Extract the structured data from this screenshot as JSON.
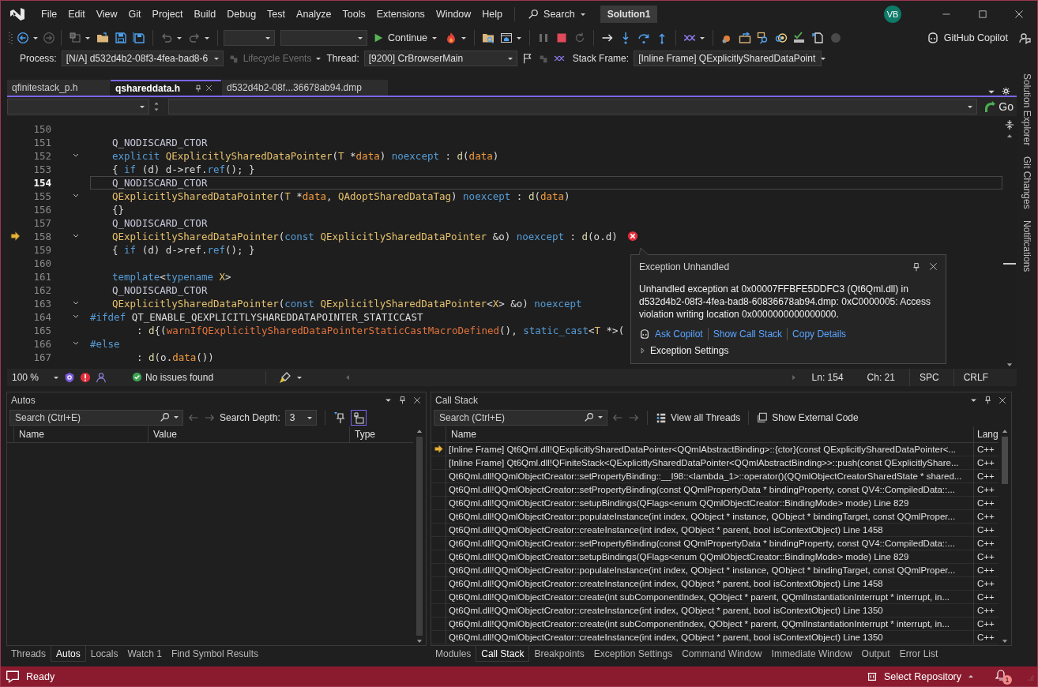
{
  "menu": {
    "items": [
      "File",
      "Edit",
      "View",
      "Git",
      "Project",
      "Build",
      "Debug",
      "Test",
      "Analyze",
      "Tools",
      "Extensions",
      "Window",
      "Help"
    ],
    "search": "Search",
    "solution": "Solution1",
    "avatar": "VB"
  },
  "toolbar": {
    "continue": "Continue",
    "copilot": "GitHub Copilot"
  },
  "debug_location": {
    "process_label": "Process:",
    "process": "[N/A] d532d4b2-08f3-4fea-bad8-6",
    "lifecycle": {
      "label": "Lifecycle Events",
      "disabled": true
    },
    "thread_label": "Thread:",
    "thread": "[9200] CrBrowserMain",
    "frame_label": "Stack Frame:",
    "frame": "[Inline Frame] QExplicitlySharedDataPoint"
  },
  "doc_tabs": [
    {
      "label": "qfinitestack_p.h",
      "selected": false
    },
    {
      "label": "qshareddata.h",
      "selected": true
    },
    {
      "label": "d532d4b2-08f...36678ab94.dmp",
      "selected": false
    }
  ],
  "nav_bar": {
    "go": "Go"
  },
  "editor": {
    "lines": [
      {
        "num": "150",
        "kind": "code",
        "fold": false,
        "current": false,
        "instruction_pointer": false,
        "error": false
      },
      {
        "num": "151",
        "kind": "code",
        "fold": false,
        "current": false,
        "instruction_pointer": false,
        "error": false,
        "tokens": [
          {
            "kind": "macro",
            "text": "Q_NODISCARD_CTOR"
          }
        ]
      },
      {
        "num": "152",
        "kind": "code",
        "fold": true,
        "current": false,
        "instruction_pointer": false,
        "error": false,
        "tokens": [
          {
            "kind": "kw",
            "text": "explicit "
          },
          {
            "kind": "type",
            "text": "QExplicitlySharedDataPointer"
          },
          {
            "kind": "plain",
            "text": "("
          },
          {
            "kind": "type",
            "text": "T"
          },
          {
            "kind": "plain",
            "text": " *"
          },
          {
            "kind": "param",
            "text": "data"
          },
          {
            "kind": "plain",
            "text": ") "
          },
          {
            "kind": "kw",
            "text": "noexcept"
          },
          {
            "kind": "plain",
            "text": " : "
          },
          {
            "kind": "fn",
            "text": "d"
          },
          {
            "kind": "plain",
            "text": "("
          },
          {
            "kind": "param",
            "text": "data"
          },
          {
            "kind": "plain",
            "text": ")"
          }
        ]
      },
      {
        "num": "153",
        "kind": "code",
        "fold": false,
        "current": false,
        "instruction_pointer": false,
        "error": false,
        "tokens": [
          {
            "kind": "plain",
            "text": "{ "
          },
          {
            "kind": "kw",
            "text": "if"
          },
          {
            "kind": "plain",
            "text": " (d) d->ref."
          },
          {
            "kind": "kw",
            "text": "ref"
          },
          {
            "kind": "plain",
            "text": "(); }"
          }
        ]
      },
      {
        "num": "154",
        "kind": "code",
        "fold": false,
        "current": true,
        "instruction_pointer": false,
        "error": false,
        "tokens": [
          {
            "kind": "macro",
            "text": "Q_NODISCARD_CTOR"
          }
        ]
      },
      {
        "num": "155",
        "kind": "code",
        "fold": true,
        "current": false,
        "instruction_pointer": false,
        "error": false,
        "tokens": [
          {
            "kind": "type",
            "text": "QExplicitlySharedDataPointer"
          },
          {
            "kind": "plain",
            "text": "("
          },
          {
            "kind": "type",
            "text": "T"
          },
          {
            "kind": "plain",
            "text": " *"
          },
          {
            "kind": "param",
            "text": "data"
          },
          {
            "kind": "plain",
            "text": ", "
          },
          {
            "kind": "type",
            "text": "QAdoptSharedDataTag"
          },
          {
            "kind": "plain",
            "text": ") "
          },
          {
            "kind": "kw",
            "text": "noexcept"
          },
          {
            "kind": "plain",
            "text": " : "
          },
          {
            "kind": "fn",
            "text": "d"
          },
          {
            "kind": "plain",
            "text": "("
          },
          {
            "kind": "param",
            "text": "data"
          },
          {
            "kind": "plain",
            "text": ")"
          }
        ]
      },
      {
        "num": "156",
        "kind": "code",
        "fold": false,
        "current": false,
        "instruction_pointer": false,
        "error": false,
        "tokens": [
          {
            "kind": "plain",
            "text": "{}"
          }
        ]
      },
      {
        "num": "157",
        "kind": "code",
        "fold": false,
        "current": false,
        "instruction_pointer": false,
        "error": false,
        "tokens": [
          {
            "kind": "macro",
            "text": "Q_NODISCARD_CTOR"
          }
        ]
      },
      {
        "num": "158",
        "kind": "code",
        "fold": true,
        "current": false,
        "instruction_pointer": true,
        "error": true,
        "tokens": [
          {
            "kind": "type",
            "text": "QExplicitlySharedDataPointer"
          },
          {
            "kind": "plain",
            "text": "("
          },
          {
            "kind": "kw",
            "text": "const "
          },
          {
            "kind": "type",
            "text": "QExplicitlySharedDataPointer"
          },
          {
            "kind": "plain",
            "text": " &o) "
          },
          {
            "kind": "kw",
            "text": "noexcept"
          },
          {
            "kind": "plain",
            "text": " : "
          },
          {
            "kind": "fn",
            "text": "d"
          },
          {
            "kind": "plain",
            "text": "(o.d)"
          }
        ]
      },
      {
        "num": "159",
        "kind": "code",
        "fold": false,
        "current": false,
        "instruction_pointer": false,
        "error": false,
        "tokens": [
          {
            "kind": "plain",
            "text": "{ "
          },
          {
            "kind": "kw",
            "text": "if"
          },
          {
            "kind": "plain",
            "text": " (d) d->ref."
          },
          {
            "kind": "kw",
            "text": "ref"
          },
          {
            "kind": "plain",
            "text": "(); }"
          }
        ]
      },
      {
        "num": "160",
        "kind": "code",
        "fold": false,
        "current": false,
        "instruction_pointer": false,
        "error": false
      },
      {
        "num": "161",
        "kind": "code",
        "fold": false,
        "current": false,
        "instruction_pointer": false,
        "error": false,
        "tokens": [
          {
            "kind": "kw",
            "text": "template"
          },
          {
            "kind": "plain",
            "text": "<"
          },
          {
            "kind": "kw",
            "text": "typename "
          },
          {
            "kind": "type",
            "text": "X"
          },
          {
            "kind": "plain",
            "text": ">"
          }
        ]
      },
      {
        "num": "162",
        "kind": "code",
        "fold": false,
        "current": false,
        "instruction_pointer": false,
        "error": false,
        "tokens": [
          {
            "kind": "macro",
            "text": "Q_NODISCARD_CTOR"
          }
        ]
      },
      {
        "num": "163",
        "kind": "code",
        "fold": true,
        "current": false,
        "instruction_pointer": false,
        "error": false,
        "tokens": [
          {
            "kind": "type",
            "text": "QExplicitlySharedDataPointer"
          },
          {
            "kind": "plain",
            "text": "("
          },
          {
            "kind": "kw",
            "text": "const "
          },
          {
            "kind": "type",
            "text": "QExplicitlySharedDataPointer"
          },
          {
            "kind": "plain",
            "text": "<"
          },
          {
            "kind": "type",
            "text": "X"
          },
          {
            "kind": "plain",
            "text": "> &o) "
          },
          {
            "kind": "kw",
            "text": "noexcept"
          }
        ]
      },
      {
        "num": "164",
        "kind": "directive",
        "fold": true,
        "current": false,
        "instruction_pointer": false,
        "error": false,
        "tokens": [
          {
            "kind": "kw",
            "text": "#ifdef"
          },
          {
            "kind": "plain",
            "text": " QT_ENABLE_QEXPLICITLYSHAREDDATAPOINTER_STATICCAST"
          }
        ]
      },
      {
        "num": "165",
        "kind": "continuation",
        "fold": false,
        "current": false,
        "instruction_pointer": false,
        "error": false,
        "tokens": [
          {
            "kind": "plain",
            "text": ": "
          },
          {
            "kind": "fn",
            "text": "d"
          },
          {
            "kind": "plain",
            "text": "{("
          },
          {
            "kind": "macrofn",
            "text": "warnIfQExplicitlySharedDataPointerStaticCastMacroDefined"
          },
          {
            "kind": "plain",
            "text": "(), "
          },
          {
            "kind": "kw",
            "text": "static_cast"
          },
          {
            "kind": "plain",
            "text": "<"
          },
          {
            "kind": "type",
            "text": "T"
          },
          {
            "kind": "plain",
            "text": " *>("
          }
        ]
      },
      {
        "num": "166",
        "kind": "directive",
        "fold": true,
        "current": false,
        "instruction_pointer": false,
        "error": false,
        "tokens": [
          {
            "kind": "kw",
            "text": "#else"
          }
        ]
      },
      {
        "num": "167",
        "kind": "continuation",
        "fold": false,
        "current": false,
        "instruction_pointer": false,
        "error": false,
        "tokens": [
          {
            "kind": "plain",
            "text": ": "
          },
          {
            "kind": "fn",
            "text": "d"
          },
          {
            "kind": "plain",
            "text": "(o."
          },
          {
            "kind": "param",
            "text": "data"
          },
          {
            "kind": "plain",
            "text": "())"
          }
        ]
      }
    ]
  },
  "editor_status": {
    "zoom": "100 %",
    "issues": "No issues found",
    "line": "Ln: 154",
    "col": "Ch: 21",
    "whitespace": "SPC",
    "line_ending": "CRLF"
  },
  "exception_popup": {
    "title": "Exception Unhandled",
    "message": "Unhandled exception at 0x00007FFBFE5DDFC3 (Qt6Qml.dll) in d532d4b2-08f3-4fea-bad8-60836678ab94.dmp: 0xC0000005: Access violation writing location 0x0000000000000000.",
    "links": [
      "Ask Copilot",
      "Show Call Stack",
      "Copy Details"
    ],
    "settings": {
      "label": "Exception Settings",
      "expanded": false
    }
  },
  "autos": {
    "title": "Autos",
    "search_placeholder": "Search (Ctrl+E)",
    "depth_label": "Search Depth:",
    "depth": "3",
    "columns": [
      "Name",
      "Value",
      "Type"
    ],
    "tabs": [
      {
        "label": "Threads",
        "selected": false
      },
      {
        "label": "Autos",
        "selected": true
      },
      {
        "label": "Locals",
        "selected": false
      },
      {
        "label": "Watch 1",
        "selected": false
      },
      {
        "label": "Find Symbol Results",
        "selected": false
      }
    ]
  },
  "call_stack": {
    "title": "Call Stack",
    "search_placeholder": "Search (Ctrl+E)",
    "view_threads": "View all Threads",
    "external_code": "Show External Code",
    "columns": [
      "Name",
      "Lang"
    ],
    "rows": [
      {
        "name": "[Inline Frame] Qt6Qml.dll!QExplicitlySharedDataPointer<QQmlAbstractBinding>::{ctor}(const QExplicitlySharedDataPointer<...",
        "lang": "C++",
        "current": true
      },
      {
        "name": "[Inline Frame] Qt6Qml.dll!QFiniteStack<QExplicitlySharedDataPointer<QQmlAbstractBinding>>::push(const QExplicitlyShare...",
        "lang": "C++",
        "current": false
      },
      {
        "name": "Qt6Qml.dll!QQmlObjectCreator::setPropertyBinding::__l98::<lambda_1>::operator()(QQmlObjectCreatorSharedState * shared...",
        "lang": "C++",
        "current": false
      },
      {
        "name": "Qt6Qml.dll!QQmlObjectCreator::setPropertyBinding(const QQmlPropertyData * bindingProperty, const QV4::CompiledData::...",
        "lang": "C++",
        "current": false
      },
      {
        "name": "Qt6Qml.dll!QQmlObjectCreator::setupBindings(QFlags<enum QQmlObjectCreator::BindingMode> mode) Line 829",
        "lang": "C++",
        "current": false
      },
      {
        "name": "Qt6Qml.dll!QQmlObjectCreator::populateInstance(int index, QObject * instance, QObject * bindingTarget, const QQmlProper...",
        "lang": "C++",
        "current": false
      },
      {
        "name": "Qt6Qml.dll!QQmlObjectCreator::createInstance(int index, QObject * parent, bool isContextObject) Line 1458",
        "lang": "C++",
        "current": false
      },
      {
        "name": "Qt6Qml.dll!QQmlObjectCreator::setPropertyBinding(const QQmlPropertyData * bindingProperty, const QV4::CompiledData::...",
        "lang": "C++",
        "current": false
      },
      {
        "name": "Qt6Qml.dll!QQmlObjectCreator::setupBindings(QFlags<enum QQmlObjectCreator::BindingMode> mode) Line 829",
        "lang": "C++",
        "current": false
      },
      {
        "name": "Qt6Qml.dll!QQmlObjectCreator::populateInstance(int index, QObject * instance, QObject * bindingTarget, const QQmlProper...",
        "lang": "C++",
        "current": false
      },
      {
        "name": "Qt6Qml.dll!QQmlObjectCreator::createInstance(int index, QObject * parent, bool isContextObject) Line 1458",
        "lang": "C++",
        "current": false
      },
      {
        "name": "Qt6Qml.dll!QQmlObjectCreator::create(int subComponentIndex, QObject * parent, QQmlInstantiationInterrupt * interrupt, in...",
        "lang": "C++",
        "current": false
      },
      {
        "name": "Qt6Qml.dll!QQmlObjectCreator::createInstance(int index, QObject * parent, bool isContextObject) Line 1350",
        "lang": "C++",
        "current": false
      },
      {
        "name": "Qt6Qml.dll!QQmlObjectCreator::create(int subComponentIndex, QObject * parent, QQmlInstantiationInterrupt * interrupt, in...",
        "lang": "C++",
        "current": false
      },
      {
        "name": "Qt6Qml.dll!QQmlObjectCreator::createInstance(int index, QObject * parent, bool isContextObject) Line 1350",
        "lang": "C++",
        "current": false
      }
    ],
    "tabs": [
      {
        "label": "Modules",
        "selected": false
      },
      {
        "label": "Call Stack",
        "selected": true
      },
      {
        "label": "Breakpoints",
        "selected": false
      },
      {
        "label": "Exception Settings",
        "selected": false
      },
      {
        "label": "Command Window",
        "selected": false
      },
      {
        "label": "Immediate Window",
        "selected": false
      },
      {
        "label": "Output",
        "selected": false
      },
      {
        "label": "Error List",
        "selected": false
      }
    ]
  },
  "side_tabs": [
    "Solution Explorer",
    "Git Changes",
    "Notifications"
  ],
  "status_bar": {
    "text": "Ready",
    "repository": "Select Repository",
    "notifications": "1"
  }
}
